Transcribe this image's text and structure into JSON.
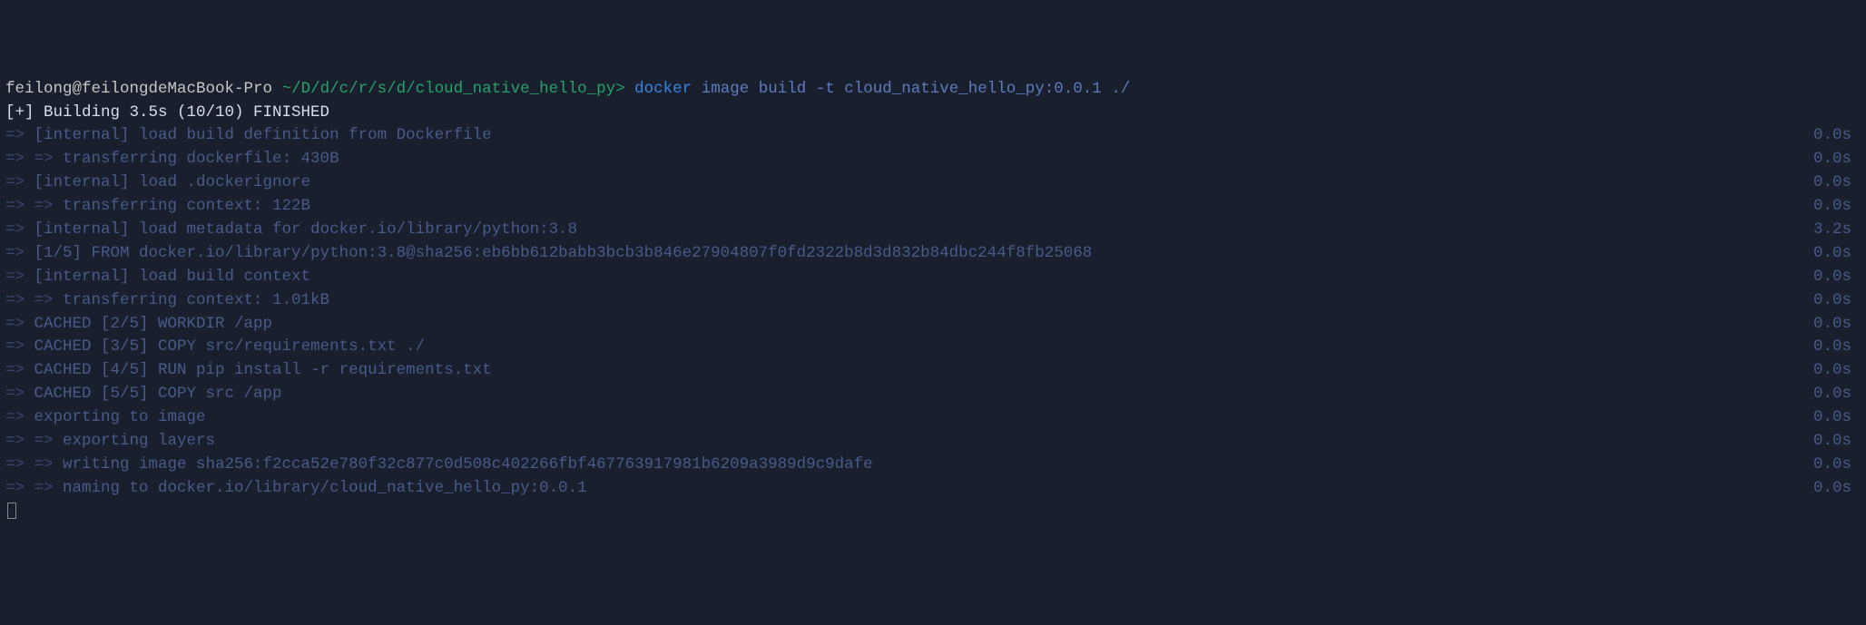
{
  "prompt": {
    "user_host": "feilong@feilongdeMacBook-Pro",
    "path": "~/D/d/c/r/s/d/cloud_native_hello_py",
    "gt": ">",
    "command_main": "docker",
    "command_rest": " image build -t cloud_native_hello_py:0.0.1 ./"
  },
  "build_header": "[+] Building 3.5s (10/10) FINISHED",
  "steps": [
    {
      "text": "=> [internal] load build definition from Dockerfile",
      "time": "0.0s"
    },
    {
      "text": "=> => transferring dockerfile: 430B",
      "time": "0.0s"
    },
    {
      "text": "=> [internal] load .dockerignore",
      "time": "0.0s"
    },
    {
      "text": "=> => transferring context: 122B",
      "time": "0.0s"
    },
    {
      "text": "=> [internal] load metadata for docker.io/library/python:3.8",
      "time": "3.2s"
    },
    {
      "text": "=> [1/5] FROM docker.io/library/python:3.8@sha256:eb6bb612babb3bcb3b846e27904807f0fd2322b8d3d832b84dbc244f8fb25068",
      "time": "0.0s"
    },
    {
      "text": "=> [internal] load build context",
      "time": "0.0s"
    },
    {
      "text": "=> => transferring context: 1.01kB",
      "time": "0.0s"
    },
    {
      "text": "=> CACHED [2/5] WORKDIR /app",
      "time": "0.0s"
    },
    {
      "text": "=> CACHED [3/5] COPY src/requirements.txt ./",
      "time": "0.0s"
    },
    {
      "text": "=> CACHED [4/5] RUN pip install -r requirements.txt",
      "time": "0.0s"
    },
    {
      "text": "=> CACHED [5/5] COPY src /app",
      "time": "0.0s"
    },
    {
      "text": "=> exporting to image",
      "time": "0.0s"
    },
    {
      "text": "=> => exporting layers",
      "time": "0.0s"
    },
    {
      "text": "=> => writing image sha256:f2cca52e780f32c877c0d508c402266fbf467763917981b6209a3989d9c9dafe",
      "time": "0.0s"
    },
    {
      "text": "=> => naming to docker.io/library/cloud_native_hello_py:0.0.1",
      "time": "0.0s"
    }
  ]
}
